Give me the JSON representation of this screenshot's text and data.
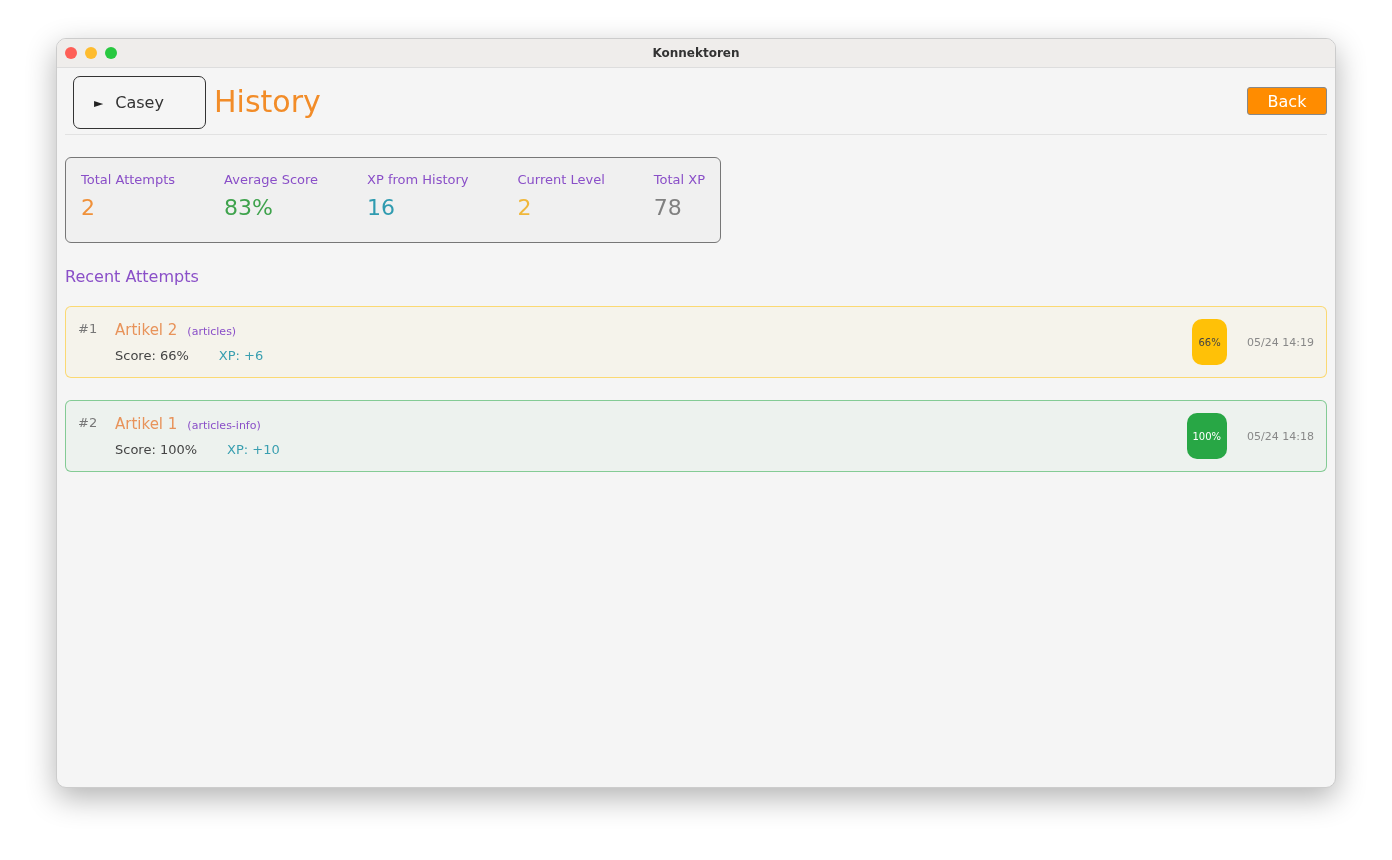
{
  "window": {
    "title": "Konnektoren"
  },
  "header": {
    "title": "History",
    "back_button": "Back"
  },
  "popup": {
    "marker": "►",
    "label": "Casey"
  },
  "stats": [
    {
      "label": "Total Attempts",
      "value": "2",
      "color": "#f0913a"
    },
    {
      "label": "Average Score",
      "value": "83%",
      "color": "#3fa34d"
    },
    {
      "label": "XP from History",
      "value": "16",
      "color": "#2f9bb0"
    },
    {
      "label": "Current Level",
      "value": "2",
      "color": "#f0b73a"
    },
    {
      "label": "Total XP",
      "value": "78",
      "color": "#808080"
    }
  ],
  "recent_title": "Recent Attempts",
  "attempts": [
    {
      "index": "#1",
      "title": "Artikel 2",
      "category": "(articles)",
      "score": "Score: 66%",
      "xp": "XP: +6",
      "badge": "66%",
      "color": "#ffc107",
      "time": "05/24 14:19"
    },
    {
      "index": "#2",
      "title": "Artikel 1",
      "category": "(articles-info)",
      "score": "Score: 100%",
      "xp": "XP: +10",
      "badge": "100%",
      "color": "#28a745",
      "time": "05/24 14:18"
    }
  ]
}
